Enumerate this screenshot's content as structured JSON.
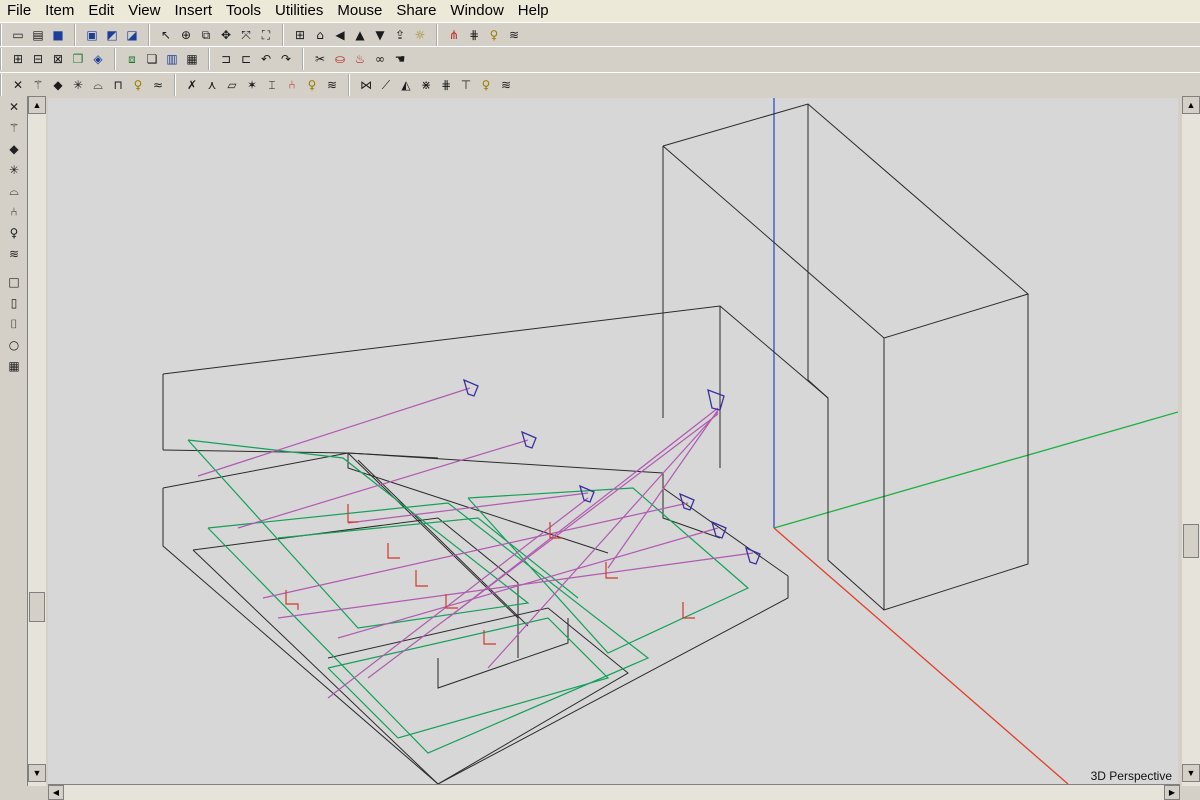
{
  "menu": {
    "file": "File",
    "item": "Item",
    "edit": "Edit",
    "view": "View",
    "insert": "Insert",
    "tools": "Tools",
    "utilities": "Utilities",
    "mouse": "Mouse",
    "share": "Share",
    "window": "Window",
    "help": "Help"
  },
  "toolbars": {
    "row1": [
      [
        "new-document-icon",
        "open-folder-icon",
        "save-disk-icon"
      ],
      [
        "render-icon",
        "render-pan-icon",
        "render-layers-icon"
      ],
      [
        "select-arrow-icon",
        "crosshair-icon",
        "zoom-window-icon",
        "move-icon",
        "zoom-extents-icon",
        "fit-view-icon"
      ],
      [
        "grid-icon",
        "camera-icon",
        "arrow-left-icon",
        "arrow-up-icon",
        "arrow-down-icon",
        "export-icon",
        "sun-icon"
      ],
      [
        "light-spot-icon",
        "light-array-icon",
        "light-bulb-icon",
        "light-wave-icon"
      ]
    ],
    "row2": [
      [
        "tile-view-icon",
        "tile-split-icon",
        "tile-quad-icon",
        "cascade-icon",
        "layer-icon"
      ],
      [
        "model-icon",
        "copy-icon",
        "chart-icon",
        "schedule-icon"
      ],
      [
        "door-icon",
        "door-open-icon",
        "undo-icon",
        "redo-icon"
      ],
      [
        "scissors-icon",
        "bucket-icon",
        "paint-icon",
        "binoculars-icon",
        "hand-icon"
      ]
    ],
    "row3": [
      [
        "close-x-icon",
        "wand-icon",
        "solid-icon",
        "spark-icon",
        "bench-icon",
        "table-icon",
        "bulb-small-icon",
        "wave-small-icon"
      ],
      [
        "vx-icon",
        "ex-icon",
        "slab-icon",
        "fan-icon",
        "stair-icon",
        "chair-small-icon",
        "bulb-alt-icon",
        "wave-alt-icon"
      ],
      [
        "beam-x-icon",
        "beam-diag-icon",
        "beam-block-icon",
        "beam-fan-icon",
        "beam-grid-icon",
        "beam-t-icon",
        "beam-bulb-icon",
        "beam-wave-icon"
      ]
    ]
  },
  "left_tools": [
    "cross-magic-icon",
    "wand-star-icon",
    "block-icon",
    "sparkle-icon",
    "desk-icon",
    "luminaire-icon",
    "lamp-icon",
    "wave-field-icon",
    "rect-icon",
    "page-icon",
    "poly-icon",
    "round-icon",
    "sphere-grid-icon"
  ],
  "viewport": {
    "label": "3D Perspective",
    "colors": {
      "background": "#d7d7d7",
      "wireframe": "#2a2a2a",
      "work_plane": "#13a05a",
      "aim_line": "#b05ab0",
      "luminaire": "#3a2fa0",
      "chair": "#d03a2a",
      "axis_x": "#e0402a",
      "axis_y": "#20b040",
      "axis_z": "#3050c8"
    }
  }
}
